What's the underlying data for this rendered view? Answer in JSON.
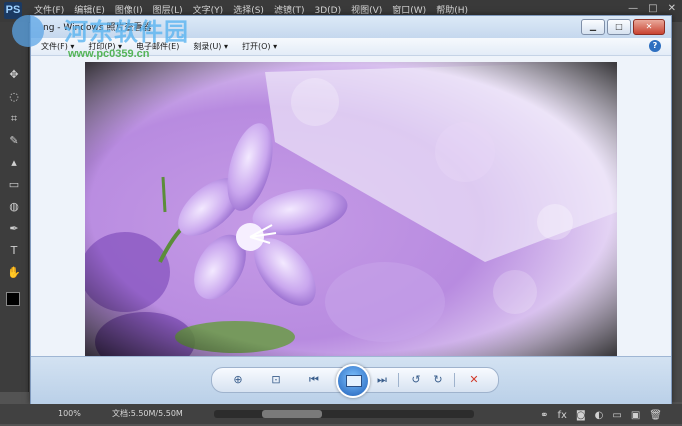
{
  "photoshop": {
    "logo": "PS",
    "menu": [
      "文件(F)",
      "编辑(E)",
      "图像(I)",
      "图层(L)",
      "文字(Y)",
      "选择(S)",
      "滤镜(T)",
      "3D(D)",
      "视图(V)",
      "窗口(W)",
      "帮助(H)"
    ],
    "window_controls": [
      "—",
      "□",
      "✕"
    ],
    "status": {
      "zoom": "100%",
      "doc_size": "文档:5.50M/5.50M"
    }
  },
  "watermark": {
    "title": "河东软件园",
    "url": "www.pc0359.cn"
  },
  "viewer": {
    "title": "ng - Windows 照片查看器",
    "menu": [
      "文件(F) ▾",
      "打印(P) ▾",
      "电子邮件(E)",
      "刻录(U) ▾",
      "打开(O) ▾"
    ],
    "help": "?",
    "controls": [
      "zoom",
      "actual-size",
      "previous",
      "slideshow",
      "next",
      "rotate-ccw",
      "rotate-cw",
      "delete"
    ]
  },
  "colors": {
    "viewer_bg": "#eef3fa",
    "ps_bg": "#535353",
    "accent": "#2e6fc0",
    "delete": "#d23a2a"
  }
}
